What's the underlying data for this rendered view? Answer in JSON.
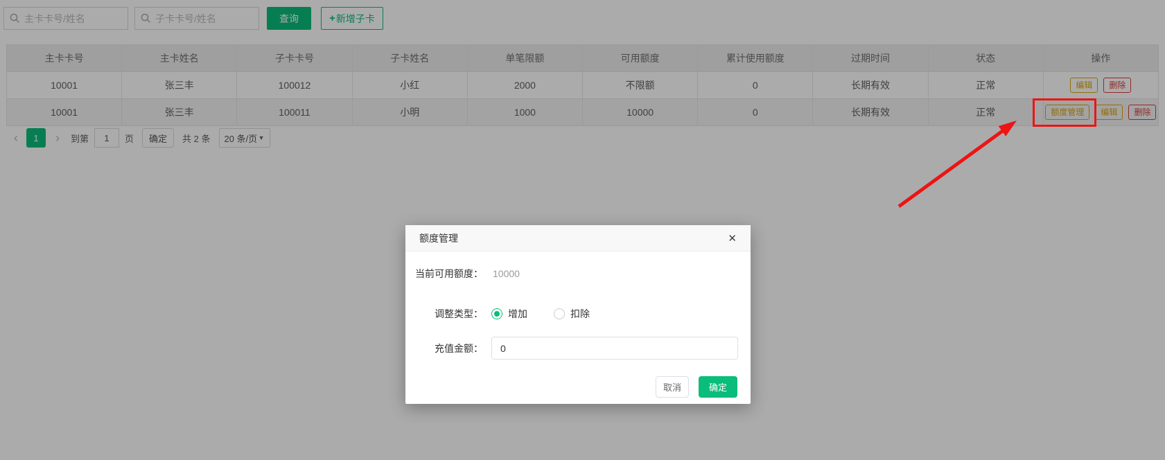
{
  "colors": {
    "primary_green": "#0ABD7A",
    "gold": "#D9A40E",
    "danger_red": "#E23B3B",
    "annotation_red": "#EC1414"
  },
  "icons": {
    "search": "magnifier",
    "plus": "+",
    "prev": "‹",
    "next": "›",
    "caret": "▼",
    "close": "✕"
  },
  "toolbar": {
    "search_main_placeholder": "主卡卡号/姓名",
    "search_sub_placeholder": "子卡卡号/姓名",
    "query_label": "查询",
    "add_label": "新增子卡"
  },
  "table": {
    "headers": [
      "主卡卡号",
      "主卡姓名",
      "子卡卡号",
      "子卡姓名",
      "单笔限额",
      "可用额度",
      "累计使用额度",
      "过期时间",
      "状态",
      "操作"
    ],
    "rows": [
      {
        "cells": [
          "10001",
          "张三丰",
          "100012",
          "小红",
          "2000",
          "不限额",
          "0",
          "长期有效",
          "正常"
        ],
        "actions": [
          {
            "label": "编辑",
            "type": "edit"
          },
          {
            "label": "删除",
            "type": "delete"
          }
        ]
      },
      {
        "cells": [
          "10001",
          "张三丰",
          "100011",
          "小明",
          "1000",
          "10000",
          "0",
          "长期有效",
          "正常"
        ],
        "actions": [
          {
            "label": "额度管理",
            "type": "quota"
          },
          {
            "label": "编辑",
            "type": "edit"
          },
          {
            "label": "删除",
            "type": "delete"
          }
        ]
      }
    ]
  },
  "pagination": {
    "current_page": "1",
    "goto_prefix": "到第",
    "goto_value": "1",
    "goto_suffix": "页",
    "confirm_label": "确定",
    "total_label": "共 2 条",
    "page_size_label": "20 条/页"
  },
  "modal": {
    "title": "额度管理",
    "current_quota_label": "当前可用额度：",
    "current_quota_value": "10000",
    "adjust_type_label": "调整类型：",
    "radio_increase_label": "增加",
    "radio_deduct_label": "扣除",
    "amount_label": "充值金额：",
    "amount_value": "0",
    "cancel_label": "取消",
    "confirm_label": "确定"
  }
}
